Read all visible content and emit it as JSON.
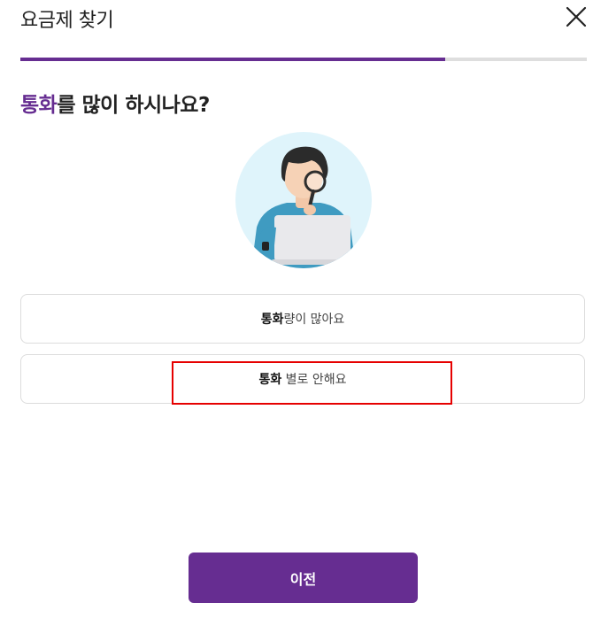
{
  "header": {
    "title": "요금제 찾기",
    "close_icon": "close-icon"
  },
  "progress": {
    "value": 0.75,
    "fill_color": "#662d91",
    "track_color": "#dedede"
  },
  "question": {
    "highlight": "통화",
    "rest": "를 많이 하시나요?"
  },
  "illustration": {
    "icon": "person-with-magnifier-and-laptop-illustration"
  },
  "options": [
    {
      "strong": "통화",
      "rest": "량이 많아요"
    },
    {
      "strong": "통화",
      "rest": " 별로 안해요"
    }
  ],
  "footer": {
    "prev_label": "이전"
  },
  "colors": {
    "brand": "#662d91",
    "annotation": "#e60000"
  }
}
